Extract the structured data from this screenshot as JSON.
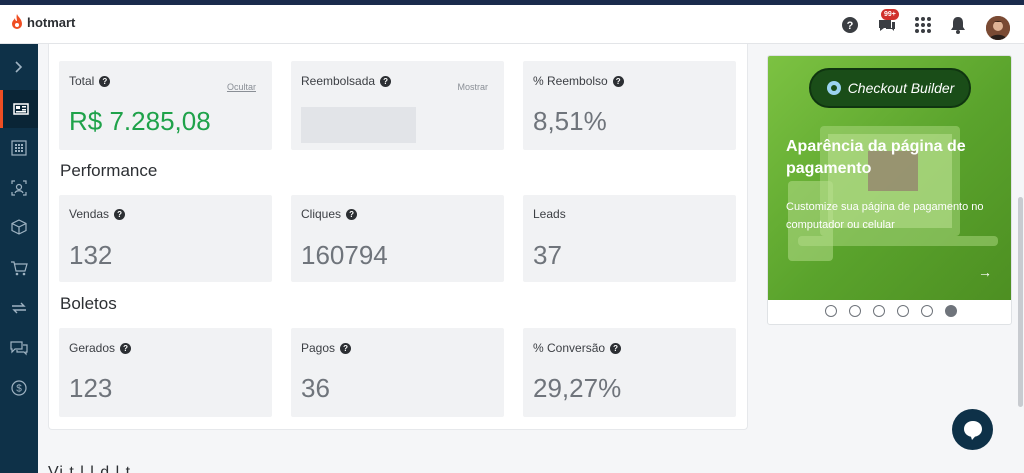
{
  "header": {
    "logo_text": "hotmart",
    "notification_badge": "99+"
  },
  "sidebar": {
    "items": [
      {
        "icon": "chevron-right-icon"
      },
      {
        "icon": "dashboard-icon",
        "active": true
      },
      {
        "icon": "grid-icon"
      },
      {
        "icon": "affiliate-icon"
      },
      {
        "icon": "box-icon"
      },
      {
        "icon": "cart-icon"
      },
      {
        "icon": "sync-icon"
      },
      {
        "icon": "chat-icon"
      },
      {
        "icon": "dollar-icon"
      }
    ]
  },
  "sales": {
    "total": {
      "label": "Total",
      "link": "Ocultar",
      "value": "R$ 7.285,08"
    },
    "reembolsada": {
      "label": "Reembolsada",
      "link": "Mostrar"
    },
    "pct_reembolso": {
      "label": "% Reembolso",
      "value": "8,51%"
    }
  },
  "performance": {
    "title": "Performance",
    "vendas": {
      "label": "Vendas",
      "value": "132"
    },
    "cliques": {
      "label": "Cliques",
      "value": "160794"
    },
    "leads": {
      "label": "Leads",
      "value": "37"
    }
  },
  "boletos": {
    "title": "Boletos",
    "gerados": {
      "label": "Gerados",
      "value": "123"
    },
    "pagos": {
      "label": "Pagos",
      "value": "36"
    },
    "conversao": {
      "label": "% Conversão",
      "value": "29,27%"
    }
  },
  "banner": {
    "pill_label": "Checkout Builder",
    "title": "Aparência da página de pagamento",
    "subtitle": "Customize sua página de pagamento no computador ou celular",
    "slide_count": 6,
    "active_slide": 6
  },
  "cutoff_text": "Vi t l l d  l  t"
}
